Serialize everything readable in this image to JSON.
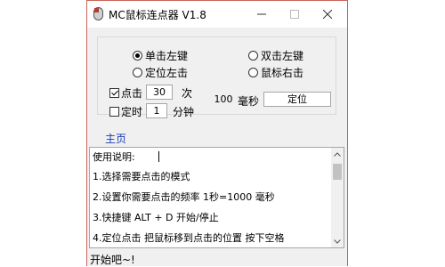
{
  "window": {
    "title": "MC鼠标连点器 V1.8",
    "icon": "mouse-icon",
    "controls": [
      "minimize-icon",
      "maximize-icon",
      "close-icon"
    ]
  },
  "mode_options": [
    {
      "label": "单击左键",
      "selected": true
    },
    {
      "label": "双击左键",
      "selected": false
    },
    {
      "label": "定位左击",
      "selected": false
    },
    {
      "label": "鼠标右击",
      "selected": false
    }
  ],
  "click_count": {
    "label": "点击",
    "checked": true,
    "value": "30",
    "unit": "次"
  },
  "timer": {
    "label": "定时",
    "checked": false,
    "value": "1",
    "unit": "分钟"
  },
  "interval": {
    "value": "100",
    "unit": "毫秒"
  },
  "locate_field": {
    "value": "定位"
  },
  "nav": {
    "home": "主页"
  },
  "instructions": {
    "lines": [
      "使用说明:",
      "1.选择需要点击的模式",
      "2.设置你需要点击的频率 1秒=1000 毫秒",
      "3.快捷键 ALT + D 开始/停止",
      "4.定位点击 把鼠标移到点击的位置 按下空格"
    ]
  },
  "status": {
    "text": "开始吧~!"
  }
}
